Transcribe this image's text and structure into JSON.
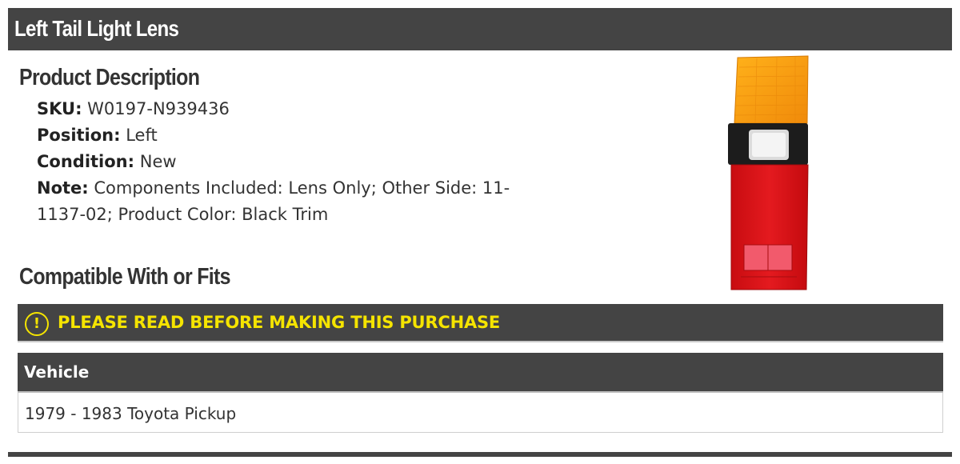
{
  "header": {
    "title": "Left Tail Light Lens"
  },
  "description": {
    "heading": "Product Description",
    "specs": [
      {
        "label": "SKU:",
        "value": "W0197-N939436"
      },
      {
        "label": "Position:",
        "value": "Left"
      },
      {
        "label": "Condition:",
        "value": "New"
      },
      {
        "label": "Note:",
        "value": "Components Included: Lens Only; Other Side: 11-1137-02; Product Color: Black Trim"
      }
    ]
  },
  "compatibility": {
    "heading": "Compatible With or Fits",
    "notice": {
      "icon": "exclamation-circle-icon",
      "text": "PLEASE READ BEFORE MAKING THIS PURCHASE"
    },
    "table": {
      "header": "Vehicle",
      "rows": [
        "1979 - 1983 Toyota Pickup"
      ]
    }
  },
  "colors": {
    "header_bg": "#444444",
    "notice_text": "#f5e400",
    "text": "#333333"
  }
}
